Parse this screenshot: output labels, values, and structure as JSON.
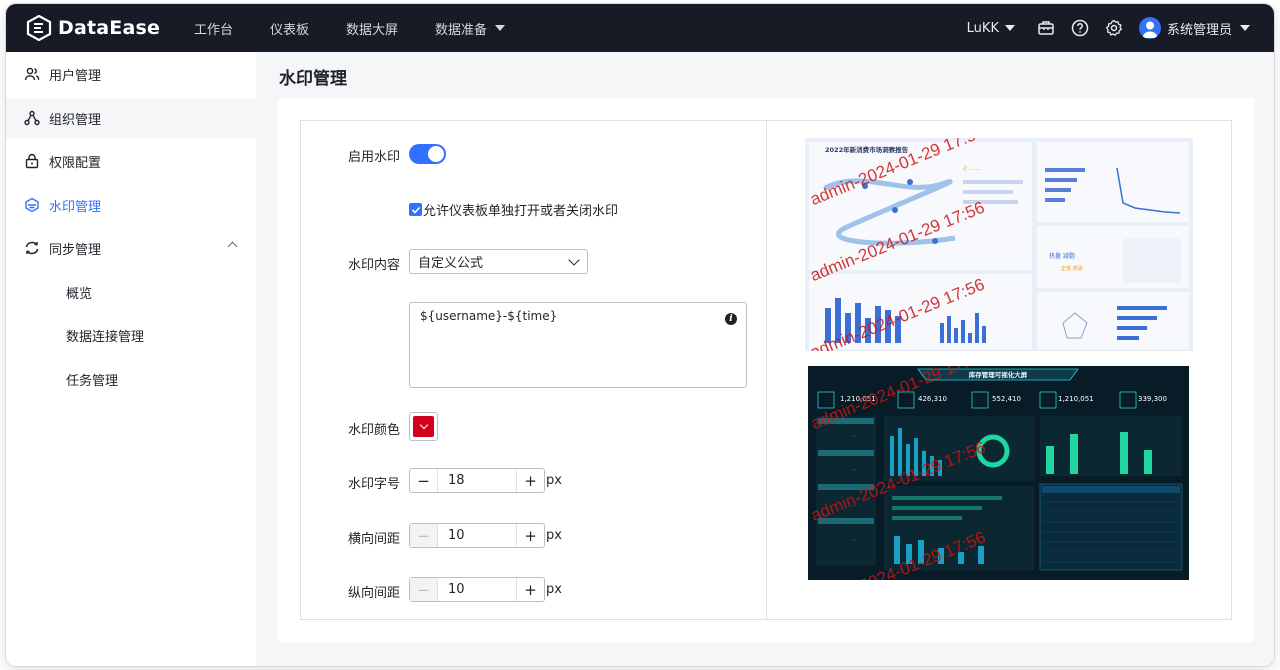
{
  "app": {
    "logo_text": "DataEase"
  },
  "nav": {
    "items": [
      {
        "label": "工作台"
      },
      {
        "label": "仪表板"
      },
      {
        "label": "数据大屏"
      },
      {
        "label": "数据准备"
      }
    ]
  },
  "topbar": {
    "org_label": "LuKK",
    "admin_label": "系统管理员"
  },
  "sidebar": {
    "items": [
      {
        "label": "用户管理"
      },
      {
        "label": "组织管理"
      },
      {
        "label": "权限配置"
      },
      {
        "label": "水印管理"
      },
      {
        "label": "同步管理"
      }
    ],
    "sub_items": [
      {
        "label": "概览"
      },
      {
        "label": "数据连接管理"
      },
      {
        "label": "任务管理"
      }
    ]
  },
  "page": {
    "title": "水印管理"
  },
  "form": {
    "enable_label": "启用水印",
    "enable_on": true,
    "allow_label": "允许仪表板单独打开或者关闭水印",
    "allow_checked": true,
    "content_label": "水印内容",
    "content_select": "自定义公式",
    "formula": "${username}-${time}",
    "color_label": "水印颜色",
    "color_value": "#d0021b",
    "font_size_label": "水印字号",
    "font_size": "18",
    "h_gap_label": "横向间距",
    "h_gap": "10",
    "v_gap_label": "纵向间距",
    "v_gap": "10",
    "unit": "px"
  },
  "preview": {
    "watermark_text": "admin-2024-01-29 17:56",
    "dashboard_title": "2022年新消费市场洞察报告",
    "screen_title": "库存管理可视化大屏",
    "screen_kpis": [
      "1,210,051",
      "426,310",
      "552,410",
      "1,210,051",
      "339,300"
    ]
  }
}
